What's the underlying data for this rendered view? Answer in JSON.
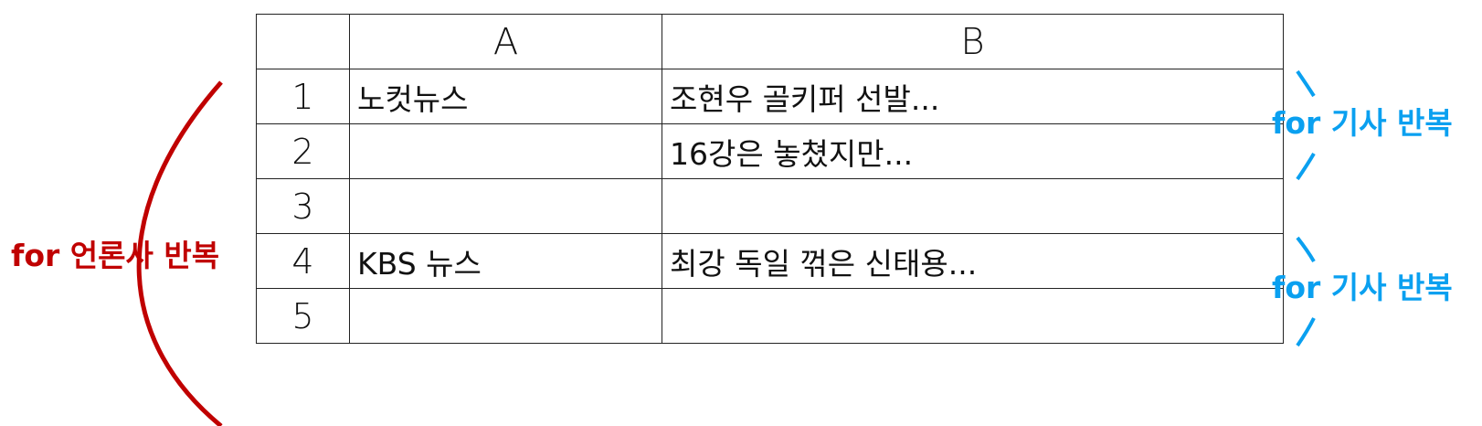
{
  "table": {
    "headers": [
      "",
      "A",
      "B"
    ],
    "rows": [
      {
        "num": "1",
        "a": "노컷뉴스",
        "b": "조현우 골키퍼 선발..."
      },
      {
        "num": "2",
        "a": "",
        "b": "16강은 놓쳤지만..."
      },
      {
        "num": "3",
        "a": "",
        "b": ""
      },
      {
        "num": "4",
        "a": "KBS 뉴스",
        "b": "최강 독일 꺾은 신태용..."
      },
      {
        "num": "5",
        "a": "",
        "b": ""
      }
    ]
  },
  "annotations": {
    "outer_loop": {
      "label": "for 언론사 반복",
      "color": "#c00000"
    },
    "inner_loops": [
      {
        "label": "for 기사 반복",
        "color": "#0aa0f0"
      },
      {
        "label": "for 기사 반복",
        "color": "#0aa0f0"
      }
    ]
  }
}
